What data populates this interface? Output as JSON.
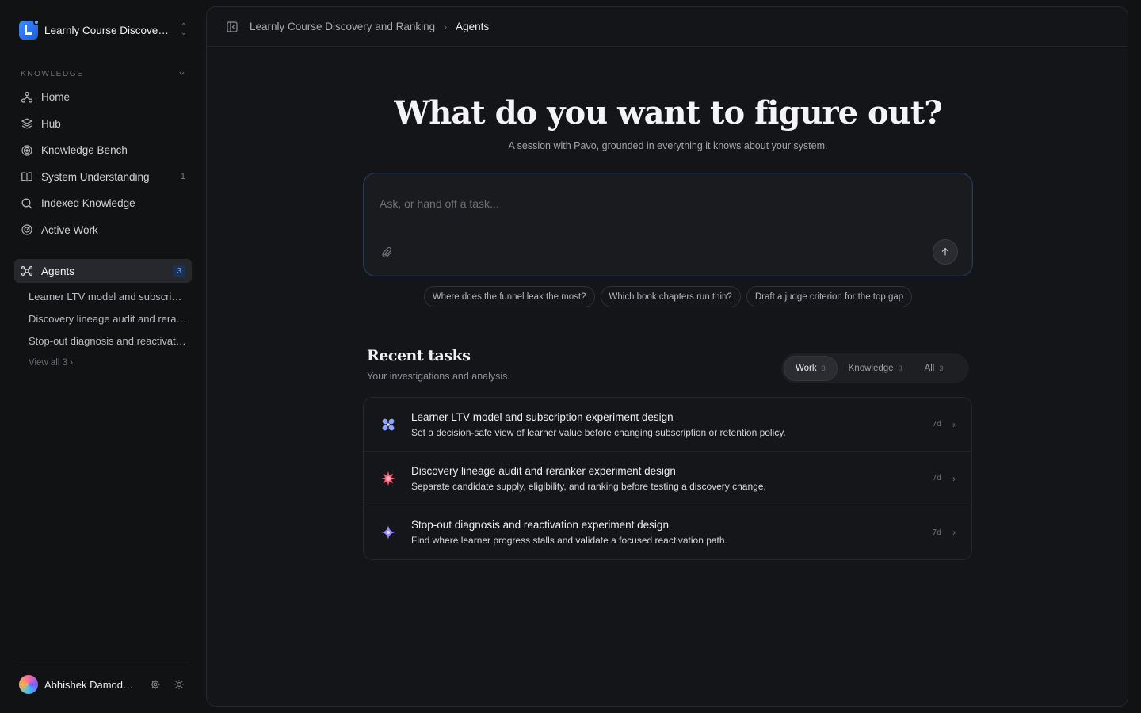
{
  "workspace": {
    "name": "Learnly Course Discovery and Ranking"
  },
  "sidebar": {
    "section_label": "KNOWLEDGE",
    "items": [
      {
        "label": "Home",
        "icon": "home-icon",
        "count": ""
      },
      {
        "label": "Hub",
        "icon": "layers-icon",
        "count": ""
      },
      {
        "label": "Knowledge Bench",
        "icon": "target-icon",
        "count": ""
      },
      {
        "label": "System Understanding",
        "icon": "book-icon",
        "count": "1"
      },
      {
        "label": "Indexed Knowledge",
        "icon": "search-icon",
        "count": ""
      },
      {
        "label": "Active Work",
        "icon": "radar-icon",
        "count": ""
      }
    ],
    "agents": {
      "label": "Agents",
      "badge": "3"
    },
    "agent_items": [
      "Learner LTV model and subscription experiment design",
      "Discovery lineage audit and reranker experiment design",
      "Stop-out diagnosis and reactivation experiment design"
    ],
    "view_all": "View all 3 ›"
  },
  "user": {
    "name": "Abhishek Damodaran"
  },
  "breadcrumb": {
    "parent": "Learnly Course Discovery and Ranking",
    "current": "Agents"
  },
  "hero": {
    "title": "What do you want to figure out?",
    "subtitle": "A session with Pavo, grounded in everything it knows about your system."
  },
  "composer": {
    "placeholder": "Ask, or hand off a task..."
  },
  "suggestions": [
    "Where does the funnel leak the most?",
    "Which book chapters run thin?",
    "Draft a judge criterion for the top gap"
  ],
  "recent": {
    "title": "Recent tasks",
    "subtitle": "Your investigations and analysis.",
    "tabs": [
      {
        "label": "Work",
        "count": "3"
      },
      {
        "label": "Knowledge",
        "count": "0"
      },
      {
        "label": "All",
        "count": "3"
      }
    ],
    "tasks": [
      {
        "title": "Learner LTV model and subscription experiment design",
        "description": "Set a decision-safe view of learner value before changing subscription or retention policy.",
        "age": "7d",
        "icon": "flower-icon",
        "color": "#8fa4ff"
      },
      {
        "title": "Discovery lineage audit and reranker experiment design",
        "description": "Separate candidate supply, eligibility, and ranking before testing a discovery change.",
        "age": "7d",
        "icon": "starburst-icon",
        "color": "#ff5a6e"
      },
      {
        "title": "Stop-out diagnosis and reactivation experiment design",
        "description": "Find where learner progress stalls and validate a focused reactivation path.",
        "age": "7d",
        "icon": "sparkle-icon",
        "color": "#9c8cff"
      }
    ]
  }
}
